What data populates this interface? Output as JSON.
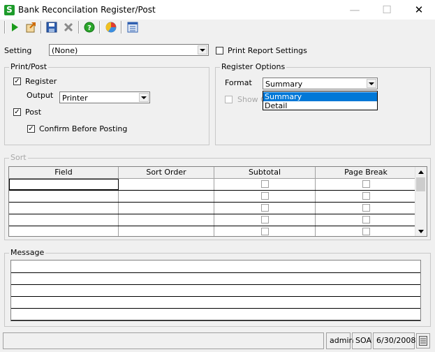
{
  "window": {
    "title": "Bank Reconcilation Register/Post",
    "app_icon_letter": "S",
    "minimize_glyph": "—",
    "maximize_glyph": "☐",
    "close_glyph": "✕"
  },
  "toolbar": {
    "buttons": [
      "run-icon",
      "export-icon",
      "save-icon",
      "delete-icon",
      "help-icon",
      "chart-icon",
      "settings-icon"
    ]
  },
  "setting": {
    "label": "Setting",
    "value": "(None)",
    "print_report_settings_label": "Print Report Settings",
    "print_report_settings_checked": false
  },
  "print_post": {
    "title": "Print/Post",
    "register_label": "Register",
    "register_checked": true,
    "output_label": "Output",
    "output_value": "Printer",
    "post_label": "Post",
    "post_checked": true,
    "confirm_label": "Confirm Before Posting",
    "confirm_checked": true
  },
  "register_options": {
    "title": "Register Options",
    "format_label": "Format",
    "format_value": "Summary",
    "show_label": "Show C",
    "format_options": [
      "Summary",
      "Detail"
    ],
    "selected_option": "Summary"
  },
  "sort": {
    "title": "Sort",
    "columns": [
      "Field",
      "Sort Order",
      "Subtotal",
      "Page Break"
    ],
    "row_count": 5
  },
  "message": {
    "title": "Message"
  },
  "status_bar": {
    "user": "admin",
    "company": "SOA",
    "date": "6/30/2008"
  },
  "colors": {
    "selection": "#0078d7",
    "app_icon": "#1e9c2b",
    "background": "#f0f0f0"
  }
}
